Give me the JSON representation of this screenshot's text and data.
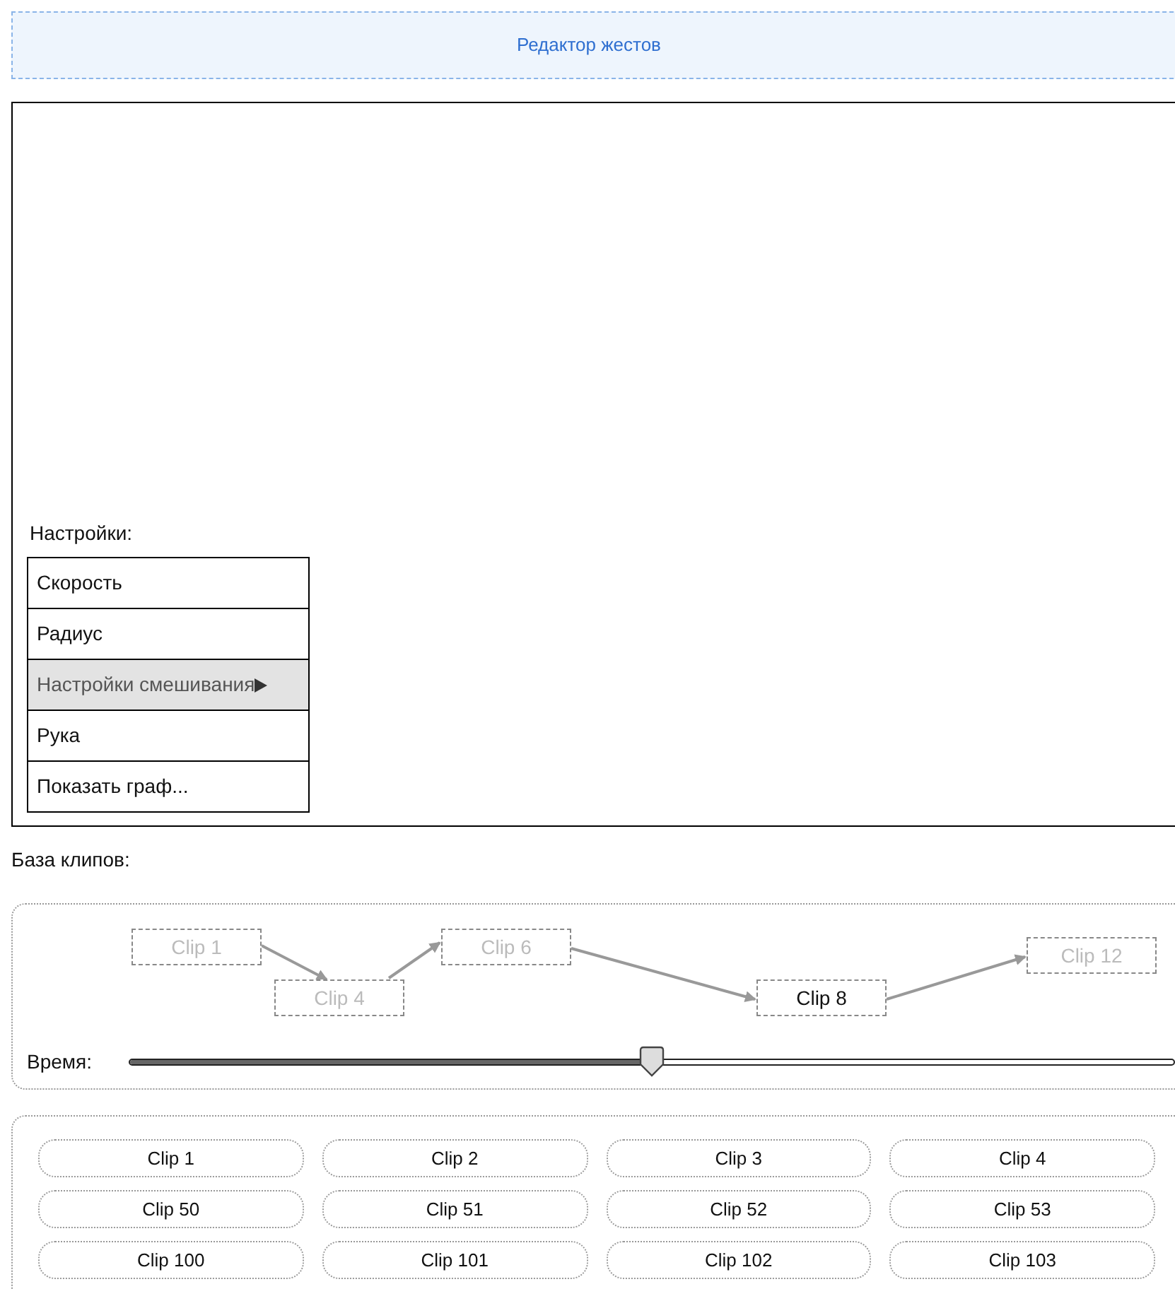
{
  "header": {
    "title": "Редактор жестов"
  },
  "settings": {
    "label": "Настройки:",
    "items": [
      {
        "label": "Скорость",
        "selected": false,
        "submenu": false
      },
      {
        "label": "Радиус",
        "selected": false,
        "submenu": false
      },
      {
        "label": "Настройки смешивания",
        "selected": true,
        "submenu": true
      },
      {
        "label": "Рука",
        "selected": false,
        "submenu": false
      },
      {
        "label": "Показать граф...",
        "selected": false,
        "submenu": false
      }
    ]
  },
  "clip_base": {
    "label": "База клипов:"
  },
  "graph": {
    "nodes": [
      {
        "label": "Clip 1",
        "active": false
      },
      {
        "label": "Clip 4",
        "active": false
      },
      {
        "label": "Clip 6",
        "active": false
      },
      {
        "label": "Clip 8",
        "active": true
      },
      {
        "label": "Clip 12",
        "active": false
      }
    ]
  },
  "time": {
    "label": "Время:",
    "level": 0.5
  },
  "clips": [
    "Clip 1",
    "Clip 2",
    "Clip 3",
    "Clip 4",
    "Clip 50",
    "Clip 51",
    "Clip 52",
    "Clip 53",
    "Clip 100",
    "Clip 101",
    "Clip 102",
    "Clip 103"
  ]
}
